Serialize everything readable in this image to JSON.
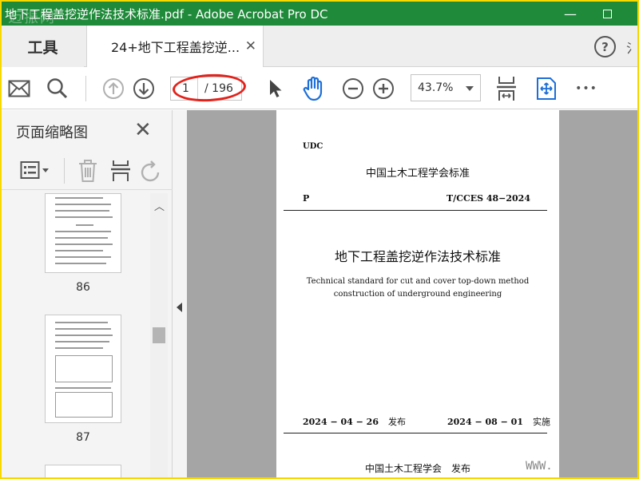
{
  "window": {
    "title": "地下工程盖挖逆作法技术标准.pdf - Adobe Acrobat Pro DC",
    "watermark": "迈振网",
    "minimize_glyph": "—"
  },
  "tabs": {
    "tools_label": "工具",
    "doc_label": "24+地下工程盖挖逆...",
    "close_glyph": "✕",
    "help_glyph": "?",
    "edge_glyph": "氵"
  },
  "toolbar": {
    "page_current": "1",
    "page_total": "/ 196",
    "zoom": "43.7%",
    "more_glyph": "•••"
  },
  "sidebar": {
    "title": "页面缩略图",
    "close_glyph": "✕",
    "thumbnails": [
      {
        "number": "86"
      },
      {
        "number": "87"
      }
    ]
  },
  "document": {
    "udc": "UDC",
    "standard_org": "中国土木工程学会标准",
    "category": "P",
    "code": "T/CCES 48−2024",
    "title_cn": "地下工程盖挖逆作法技术标准",
    "title_en_line1": "Technical standard for cut and cover top-down method",
    "title_en_line2": "construction of underground engineering",
    "issue_date": "2024 − 04 − 26",
    "issue_label": "发布",
    "effective_date": "2024 − 08 − 01",
    "effective_label": "实施",
    "publisher": "中国土木工程学会　发布",
    "www": "WWW."
  },
  "colors": {
    "titlebar": "#1f8a3a",
    "accent_blue": "#1d6fd8",
    "annotation_red": "#e2221b",
    "screen_border": "#f7d900"
  }
}
